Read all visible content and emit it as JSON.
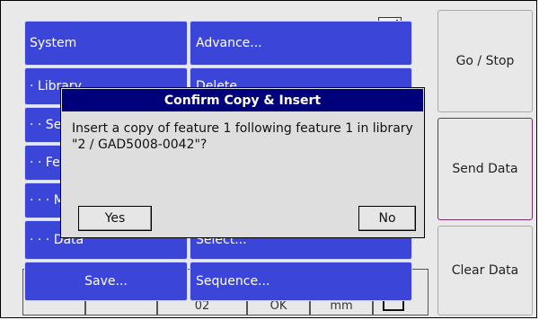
{
  "side_buttons": [
    {
      "label": "Go / Stop"
    },
    {
      "label": "Send Data"
    },
    {
      "label": "Clear Data"
    }
  ],
  "menu": {
    "left": [
      {
        "label": "System"
      },
      {
        "label": "· Library"
      },
      {
        "label": "· · Se"
      },
      {
        "label": "· · Fe"
      },
      {
        "label": "· · · M"
      },
      {
        "label": "· · · Data"
      },
      {
        "label": "Save..."
      }
    ],
    "right": [
      {
        "label": "Advance..."
      },
      {
        "label": "Delete..."
      },
      {
        "label": ""
      },
      {
        "label": ""
      },
      {
        "label": ""
      },
      {
        "label": "Select..."
      },
      {
        "label": "Sequence..."
      }
    ]
  },
  "status_strip": {
    "cells": [
      "",
      "",
      "02",
      "OK",
      "mm",
      ""
    ]
  },
  "dialog": {
    "title": "Confirm Copy & Insert",
    "message": "Insert a copy of feature 1 following feature 1 in library \"2 / GAD5008-0042\"?",
    "yes_label": "Yes",
    "no_label": "No"
  }
}
